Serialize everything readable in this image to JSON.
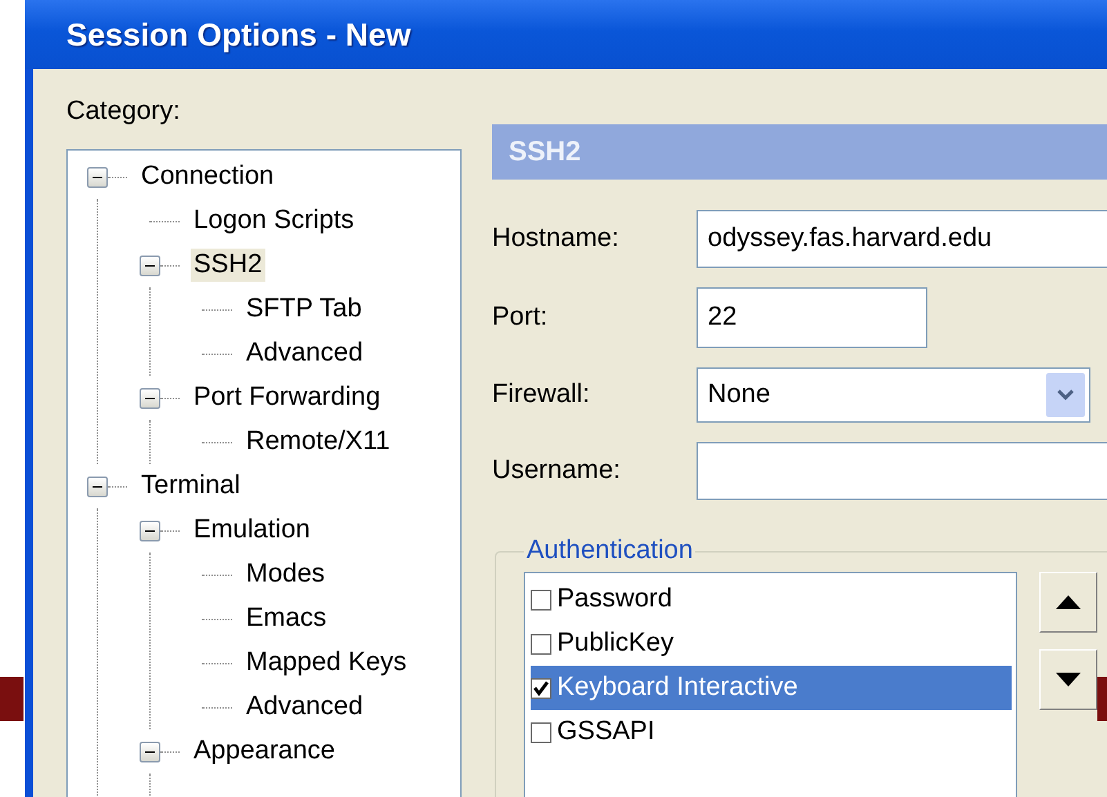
{
  "window": {
    "title": "Session Options - New"
  },
  "category_label": "Category:",
  "tree": [
    {
      "label": "Connection",
      "expanded": true,
      "selected": false,
      "children": [
        {
          "label": "Logon Scripts",
          "selected": false
        },
        {
          "label": "SSH2",
          "expanded": true,
          "selected": true,
          "children": [
            {
              "label": "SFTP Tab",
              "selected": false
            },
            {
              "label": "Advanced",
              "selected": false
            }
          ]
        },
        {
          "label": "Port Forwarding",
          "expanded": true,
          "selected": false,
          "children": [
            {
              "label": "Remote/X11",
              "selected": false
            }
          ]
        }
      ]
    },
    {
      "label": "Terminal",
      "expanded": true,
      "selected": false,
      "children": [
        {
          "label": "Emulation",
          "expanded": true,
          "selected": false,
          "children": [
            {
              "label": "Modes",
              "selected": false
            },
            {
              "label": "Emacs",
              "selected": false
            },
            {
              "label": "Mapped Keys",
              "selected": false
            },
            {
              "label": "Advanced",
              "selected": false
            }
          ]
        },
        {
          "label": "Appearance",
          "expanded": true,
          "selected": false
        }
      ]
    }
  ],
  "panel": {
    "title": "SSH2",
    "fields": [
      {
        "kind": "text",
        "label": "Hostname:",
        "value": "odyssey.fas.harvard.edu"
      },
      {
        "kind": "short",
        "label": "Port:",
        "value": "22"
      },
      {
        "kind": "select",
        "label": "Firewall:",
        "value": "None"
      },
      {
        "kind": "text",
        "label": "Username:"
      }
    ]
  },
  "authentication": {
    "title": "Authentication",
    "methods": [
      {
        "label": "Password",
        "checked": false,
        "selected": false
      },
      {
        "label": "PublicKey",
        "checked": false,
        "selected": false
      },
      {
        "label": "Keyboard Interactive",
        "checked": true,
        "selected": true
      },
      {
        "label": "GSSAPI",
        "checked": false,
        "selected": false
      }
    ]
  }
}
